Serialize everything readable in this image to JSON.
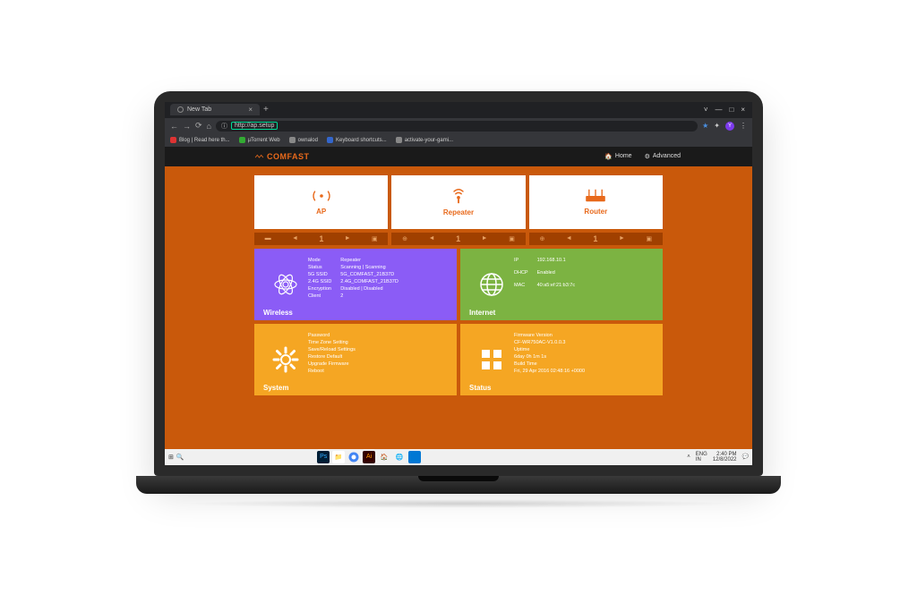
{
  "browser": {
    "tab_title": "New Tab",
    "url": "http://ap.setup",
    "bookmarks": [
      "Blog | Read here th...",
      "µTorrent Web",
      "ownalod",
      "Keyboard shortcuts...",
      "activate-your-gami..."
    ]
  },
  "header": {
    "brand": "COMFAST",
    "nav_home": "Home",
    "nav_advanced": "Advanced"
  },
  "modes": {
    "ap": "AP",
    "repeater": "Repeater",
    "router": "Router"
  },
  "indicator_num": "1",
  "wireless": {
    "title": "Wireless",
    "labels": [
      "Mode",
      "Status",
      "5G SSID",
      "2.4G SSID",
      "Encryption",
      "Client"
    ],
    "values": [
      "Repeater",
      "Scanning | Scanning",
      "5G_COMFAST_21B37D",
      "2.4G_COMFAST_21B37D",
      "Disabled | Disabled",
      "2"
    ]
  },
  "internet": {
    "title": "Internet",
    "labels": [
      "IP",
      "DHCP",
      "MAC"
    ],
    "values": [
      "192.168.10.1",
      "Enabled",
      "40:a5:ef:21:b3:7c"
    ]
  },
  "system": {
    "title": "System",
    "items": [
      "Password",
      "Time Zone Setting",
      "Save/Reload Settings",
      "Restore Default",
      "Upgrade Firmware",
      "Reboot"
    ]
  },
  "status": {
    "title": "Status",
    "items": [
      "Firmware Version",
      "CF-WR750AC-V1.0.0.3",
      "Uptime",
      "6day 0h 1m 1s",
      "Build Time",
      "Fri, 29 Apr 2016 02:48:16 +0000"
    ]
  },
  "taskbar": {
    "lang1": "ENG",
    "lang2": "IN",
    "time": "2:40 PM",
    "date": "12/8/2022"
  }
}
